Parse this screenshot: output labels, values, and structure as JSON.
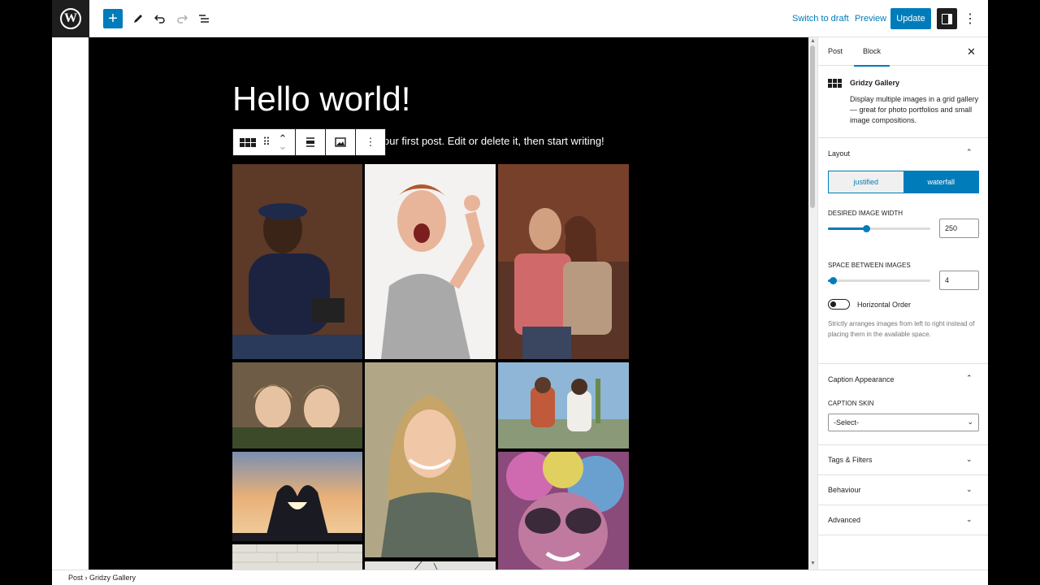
{
  "toolbar": {
    "add_icon": "plus-icon",
    "edit_icon": "pencil-icon",
    "undo_icon": "undo-icon",
    "redo_icon": "redo-icon",
    "outline_icon": "list-view-icon",
    "switch_to_draft": "Switch to draft",
    "preview": "Preview",
    "update": "Update"
  },
  "editor": {
    "title": "Hello world!",
    "paragraph": "our first post. Edit or delete it, then start writing!"
  },
  "block_toolbar": {
    "icons": [
      "gallery-icon",
      "drag-handle-icon",
      "move-icon",
      "align-icon",
      "replace-image-icon",
      "more-options-icon"
    ]
  },
  "gallery": {
    "images": [
      {
        "name": "man-with-camera",
        "color": "#5a3b2c"
      },
      {
        "name": "woman-shouting",
        "color": "#e8e6e2"
      },
      {
        "name": "couple-autumn",
        "color": "#6b3a2a"
      },
      {
        "name": "two-girls",
        "color": "#7c6650"
      },
      {
        "name": "blonde-woman",
        "color": "#a99e80"
      },
      {
        "name": "couple-park",
        "color": "#7fa7c6"
      },
      {
        "name": "heart-hands-sunset",
        "color": "#c98a55"
      },
      {
        "name": "holi-colors",
        "color": "#b04d8c"
      },
      {
        "name": "white-brick",
        "color": "#dedbd4"
      },
      {
        "name": "tree-snow",
        "color": "#d8d6d2"
      }
    ]
  },
  "sidebar": {
    "tabs": [
      "Post",
      "Block"
    ],
    "block": {
      "title": "Gridzy Gallery",
      "description": "Display multiple images in a grid gallery — great for photo portfolios and small image compositions."
    },
    "layout": {
      "title": "Layout",
      "options": [
        "justified",
        "waterfall"
      ],
      "selected": "waterfall",
      "desired_width_label": "DESIRED IMAGE WIDTH",
      "desired_width_value": "250",
      "desired_width_fraction": 0.37,
      "space_label": "SPACE BETWEEN IMAGES",
      "space_value": "4",
      "space_fraction": 0.05,
      "horizontal_order_label": "Horizontal Order",
      "horizontal_order_on": false,
      "horizontal_order_help": "Strictly arranges images from left to right instead of placing them in the available space."
    },
    "caption": {
      "title": "Caption Appearance",
      "skin_label": "CAPTION SKIN",
      "skin_value": "-Select-"
    },
    "panels": [
      "Tags & Filters",
      "Behaviour",
      "Advanced"
    ]
  },
  "breadcrumb": [
    "Post",
    "Gridzy Gallery"
  ]
}
